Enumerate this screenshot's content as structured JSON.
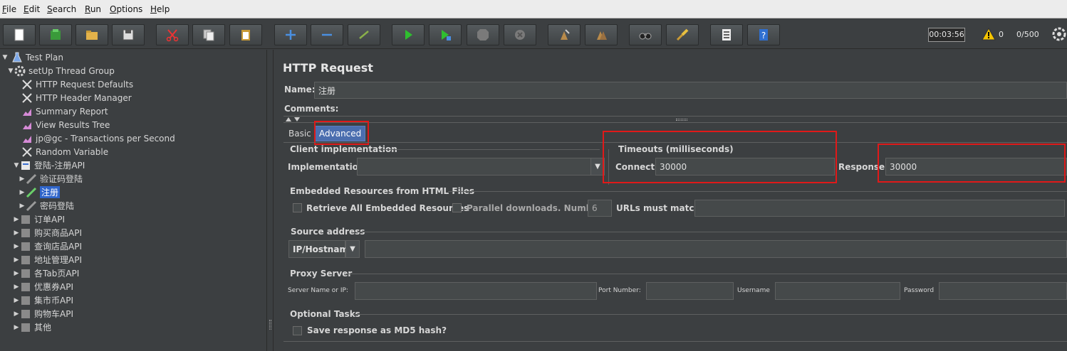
{
  "menu": [
    {
      "mnemonic": "F",
      "rest": "ile"
    },
    {
      "mnemonic": "E",
      "rest": "dit"
    },
    {
      "mnemonic": "S",
      "rest": "earch"
    },
    {
      "mnemonic": "R",
      "rest": "un"
    },
    {
      "mnemonic": "O",
      "rest": "ptions"
    },
    {
      "mnemonic": "H",
      "rest": "elp"
    }
  ],
  "toolbar": {
    "timer": "00:03:56",
    "warning_count": "0",
    "thread_count": "0/500",
    "icons": [
      "new-icon",
      "templates-icon",
      "open-icon",
      "save-icon",
      "cut-icon",
      "copy-icon",
      "paste-icon",
      "expand-icon",
      "collapse-icon",
      "toggle-icon",
      "start-icon",
      "start-no-pauses-icon",
      "stop-icon",
      "shutdown-icon",
      "clear-icon",
      "clear-all-icon",
      "search-icon",
      "reset-search-icon",
      "function-helper-icon",
      "help-icon"
    ]
  },
  "tree": {
    "items": [
      {
        "label": "Test Plan",
        "icon": "test-plan-icon",
        "toggle": "▼"
      },
      {
        "label": "setUp Thread Group",
        "icon": "thread-group-icon",
        "toggle": "▼"
      },
      {
        "label": "HTTP Request Defaults",
        "icon": "config-icon",
        "toggle": ""
      },
      {
        "label": "HTTP Header Manager",
        "icon": "config-icon",
        "toggle": ""
      },
      {
        "label": "Summary Report",
        "icon": "listener-icon",
        "toggle": ""
      },
      {
        "label": "View Results Tree",
        "icon": "listener-icon",
        "toggle": ""
      },
      {
        "label": "jp@gc - Transactions per Second",
        "icon": "listener-icon",
        "toggle": ""
      },
      {
        "label": "Random Variable",
        "icon": "config-icon",
        "toggle": ""
      },
      {
        "label": "登陆-注册API",
        "icon": "controller-icon",
        "toggle": "▼"
      },
      {
        "label": "验证码登陆",
        "icon": "sampler-icon",
        "toggle": "▶"
      },
      {
        "label": "注册",
        "icon": "sampler-icon",
        "toggle": "▶"
      },
      {
        "label": "密码登陆",
        "icon": "sampler-icon",
        "toggle": "▶"
      },
      {
        "label": "订单API",
        "icon": "controller-icon",
        "toggle": "▶"
      },
      {
        "label": "购买商品API",
        "icon": "controller-icon",
        "toggle": "▶"
      },
      {
        "label": "查询店品API",
        "icon": "controller-icon",
        "toggle": "▶"
      },
      {
        "label": "地址管理API",
        "icon": "controller-icon",
        "toggle": "▶"
      },
      {
        "label": "各Tab页API",
        "icon": "controller-icon",
        "toggle": "▶"
      },
      {
        "label": "优惠券API",
        "icon": "controller-icon",
        "toggle": "▶"
      },
      {
        "label": "集市币API",
        "icon": "controller-icon",
        "toggle": "▶"
      },
      {
        "label": "购物车API",
        "icon": "controller-icon",
        "toggle": "▶"
      },
      {
        "label": "其他",
        "icon": "controller-icon",
        "toggle": "▶"
      }
    ],
    "selected": "注册"
  },
  "panel": {
    "title": "HTTP Request",
    "name_label": "Name:",
    "name_value": "注册",
    "comments_label": "Comments:",
    "tabs": [
      "Basic",
      "Advanced"
    ],
    "active_tab": "Advanced",
    "client_impl": {
      "title": "Client implementation",
      "label": "Implementation:",
      "value": ""
    },
    "timeouts": {
      "title": "Timeouts (milliseconds)",
      "connect_label": "Connect:",
      "connect_value": "30000",
      "response_label": "Response:",
      "response_value": "30000"
    },
    "embedded": {
      "title": "Embedded Resources from HTML Files",
      "retrieve_label": "Retrieve All Embedded Resources",
      "parallel_label": "Parallel downloads. Number:",
      "parallel_value": "6",
      "urls_label": "URLs must match:",
      "urls_value": ""
    },
    "source": {
      "title": "Source address",
      "type_value": "IP/Hostname",
      "address_value": ""
    },
    "proxy": {
      "title": "Proxy Server",
      "server_label": "Server Name or IP:",
      "port_label": "Port Number:",
      "username_label": "Username",
      "password_label": "Password"
    },
    "optional": {
      "title": "Optional Tasks",
      "md5_label": "Save response as MD5 hash?"
    }
  },
  "colors": {
    "highlight": "#e01919",
    "selection": "#2f65ca",
    "active_tab": "#4b6eaf"
  }
}
